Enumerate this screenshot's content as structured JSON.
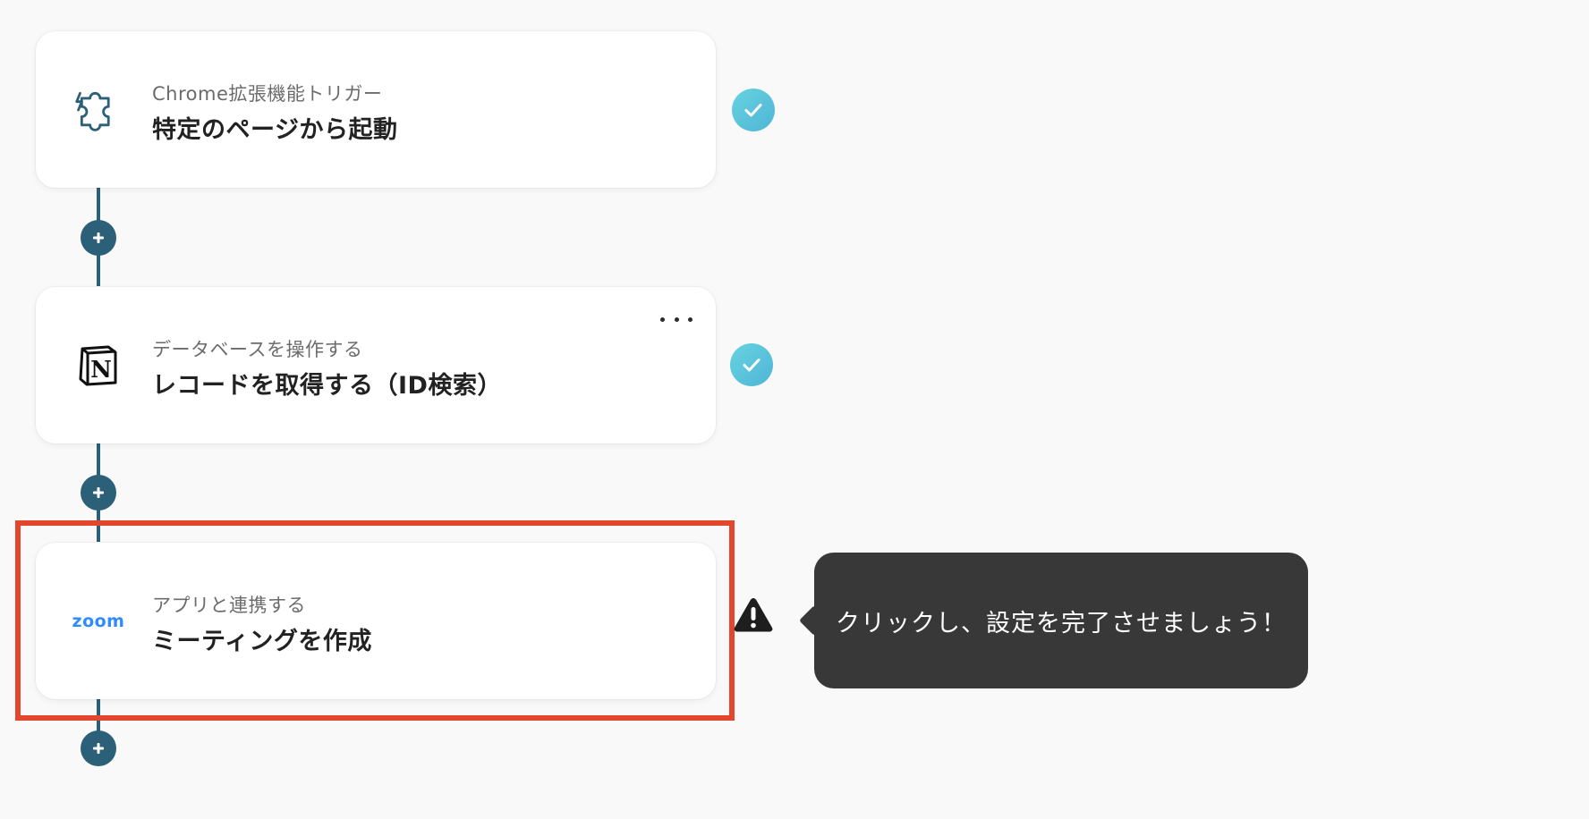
{
  "steps": [
    {
      "app_icon": "chrome-extension-puzzle-icon",
      "subtitle": "Chrome拡張機能トリガー",
      "title": "特定のページから起動",
      "status": "completed"
    },
    {
      "app_icon": "notion-icon",
      "subtitle": "データベースを操作する",
      "title": "レコードを取得する（ID検索）",
      "status": "completed"
    },
    {
      "app_icon": "zoom-icon",
      "logo_text": "zoom",
      "subtitle": "アプリと連携する",
      "title": "ミーティングを作成",
      "status": "warning"
    }
  ],
  "tooltip": {
    "text": "クリックし、設定を完了させましょう！"
  },
  "colors": {
    "connector": "#2c5f78",
    "check_start": "#67d3e0",
    "check_end": "#4fb5d6",
    "highlight": "#e2462c",
    "tooltip_bg": "#383838",
    "zoom_brand": "#2d8cff"
  }
}
